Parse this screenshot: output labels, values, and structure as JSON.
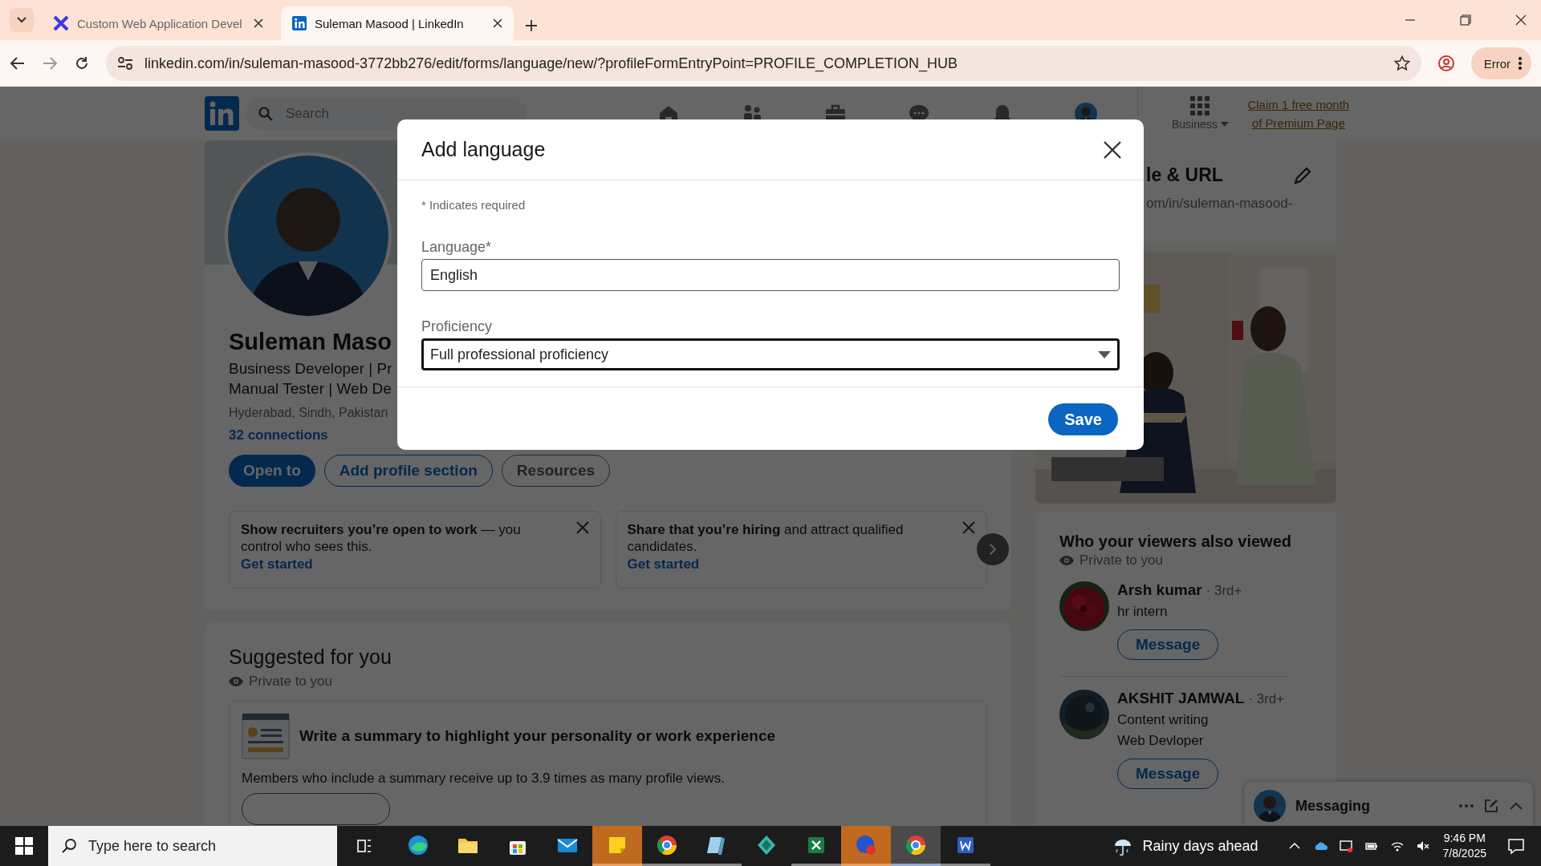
{
  "browser": {
    "tabs": [
      {
        "title": "Custom Web Application Devel",
        "kind": "cross",
        "selected": false
      },
      {
        "title": "Suleman Masood | LinkedIn",
        "kind": "in",
        "selected": true
      }
    ],
    "url": "linkedin.com/in/suleman-masood-3772bb276/edit/forms/language/new/?profileFormEntryPoint=PROFILE_COMPLETION_HUB",
    "profile_button": "Error"
  },
  "nav": {
    "search_placeholder": "Search",
    "business": "Business",
    "premium": "Claim 1 free month of Premium Page"
  },
  "profile": {
    "name": "Suleman Maso",
    "headline": [
      "Business Developer | Pr",
      "Manual Tester | Web De"
    ],
    "location": "Hyderabad, Sindh, Pakistan",
    "connections": "32 connections",
    "buttons": [
      {
        "label": "Open to",
        "kind": "primary"
      },
      {
        "label": "Add profile section",
        "kind": "secondary"
      },
      {
        "label": "Resources",
        "kind": "tertiary"
      }
    ],
    "prompts": [
      {
        "text": "**Show recruiters you’re open to work** — you control who sees this.",
        "link": "Get started"
      },
      {
        "text": "**Share that you’re hiring** and attract qualified candidates.",
        "link": "Get started"
      }
    ]
  },
  "suggested": {
    "title": "Suggested for you",
    "privacy": "Private to you",
    "item_title": "Write a summary to highlight your personality or work experience",
    "item_text": "Members who include a summary receive up to 3.9 times as many profile views."
  },
  "right": {
    "url_card": {
      "title": "le & URL",
      "url": "om/in/suleman-masood-"
    },
    "viewers": {
      "title": "Who your viewers also viewed",
      "privacy": "Private to you",
      "people": [
        {
          "name": "Arsh kumar",
          "degree": "· 3rd+",
          "lines": [
            "hr intern"
          ],
          "button": "Message"
        },
        {
          "name": "AKSHIT JAMWAL",
          "degree": "· 3rd+",
          "lines": [
            "Content writing",
            "Web Devloper"
          ],
          "button": "Message"
        }
      ]
    }
  },
  "messaging": {
    "title": "Messaging"
  },
  "modal": {
    "title": "Add language",
    "required_note": "* Indicates required",
    "fields": [
      {
        "label": "Language*",
        "value": "English",
        "kind": "text",
        "focused": false
      },
      {
        "label": "Proficiency",
        "value": "Full professional proficiency",
        "kind": "select",
        "focused": true
      }
    ],
    "save": "Save"
  },
  "taskbar": {
    "search_placeholder": "Type here to search",
    "apps": [
      {
        "kind": "globe",
        "open": false,
        "attention": false,
        "selected": false
      },
      {
        "kind": "folder",
        "open": false,
        "attention": false,
        "selected": false
      },
      {
        "kind": "bag",
        "open": false,
        "attention": false,
        "selected": false
      },
      {
        "kind": "mail",
        "open": false,
        "attention": false,
        "selected": false
      },
      {
        "kind": "note",
        "open": true,
        "attention": true,
        "selected": false
      },
      {
        "kind": "ring",
        "open": true,
        "attention": false,
        "selected": false
      },
      {
        "kind": "book",
        "open": true,
        "attention": false,
        "selected": false
      },
      {
        "kind": "gem",
        "open": false,
        "attention": false,
        "selected": false
      },
      {
        "kind": "sheet",
        "open": true,
        "attention": false,
        "selected": false
      },
      {
        "kind": "badge",
        "open": true,
        "attention": true,
        "selected": false
      },
      {
        "kind": "ring",
        "open": true,
        "attention": false,
        "selected": true
      },
      {
        "kind": "doc",
        "open": true,
        "attention": false,
        "selected": false
      }
    ],
    "weather": "Rainy days ahead",
    "time": "9:46 PM",
    "date": "7/8/2025"
  }
}
